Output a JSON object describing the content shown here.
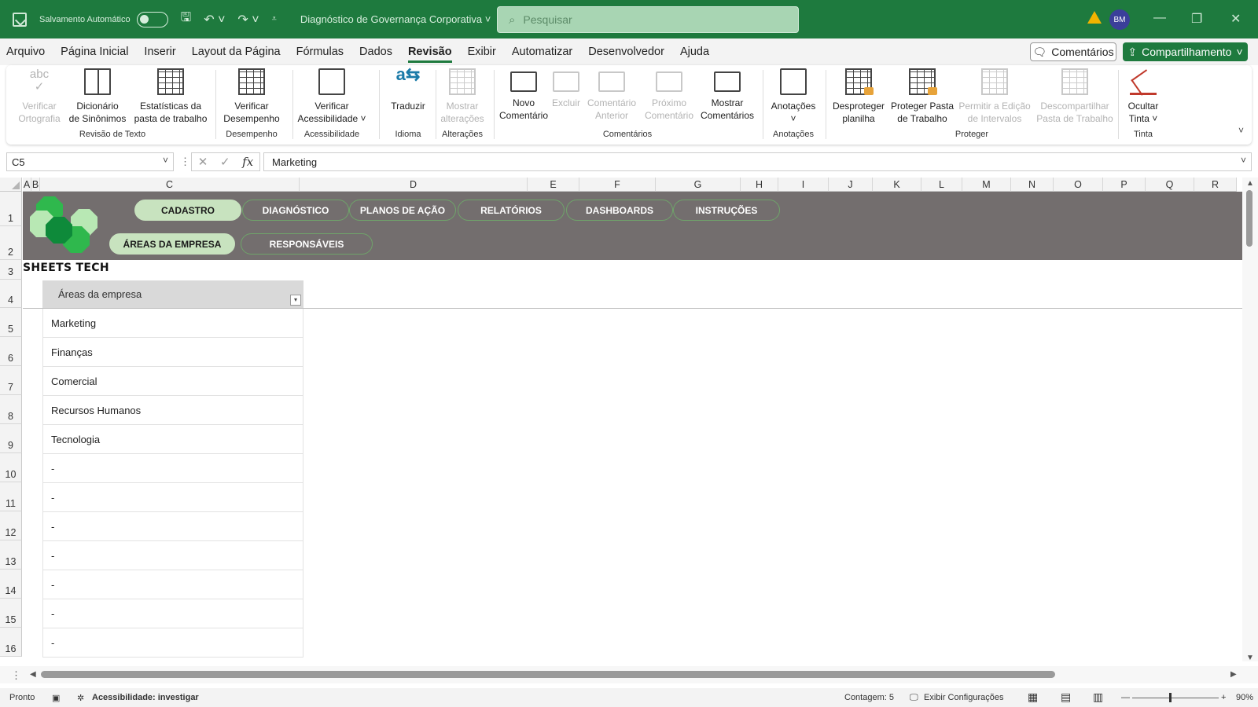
{
  "title_bar": {
    "autosave_label": "Salvamento Automático",
    "document_title": "Diagnóstico de Governança Corporativa",
    "search_placeholder": "Pesquisar",
    "user_initials": "BM"
  },
  "menu": {
    "tabs": [
      "Arquivo",
      "Página Inicial",
      "Inserir",
      "Layout da Página",
      "Fórmulas",
      "Dados",
      "Revisão",
      "Exibir",
      "Automatizar",
      "Desenvolvedor",
      "Ajuda"
    ],
    "active_tab": "Revisão",
    "comments_button": "Comentários",
    "share_button": "Compartilhamento"
  },
  "ribbon": {
    "buttons": {
      "spell": "Verificar\nOrtografia",
      "thesaurus": "Dicionário\nde Sinônimos",
      "stats": "Estatísticas da\npasta de trabalho",
      "performance": "Verificar\nDesempenho",
      "accessibility": "Verificar\nAcessibilidade ˅",
      "translate": "Traduzir",
      "show_changes": "Mostrar\nalterações",
      "new_comment": "Novo\nComentário",
      "delete": "Excluir",
      "prev_comment": "Comentário\nAnterior",
      "next_comment": "Próximo\nComentário",
      "show_comments": "Mostrar\nComentários",
      "notes": "Anotações\n˅",
      "unprotect_sheet": "Desproteger\nplanilha",
      "protect_workbook": "Proteger Pasta\nde Trabalho",
      "allow_edit_ranges": "Permitir a Edição\nde Intervalos",
      "unshare_workbook": "Descompartilhar\nPasta de Trabalho",
      "hide_ink": "Ocultar\nTinta ˅"
    },
    "groups": {
      "proofing": "Revisão de Texto",
      "performance": "Desempenho",
      "accessibility": "Acessibilidade",
      "language": "Idioma",
      "changes": "Alterações",
      "comments": "Comentários",
      "notes": "Anotações",
      "protect": "Proteger",
      "ink": "Tinta"
    }
  },
  "formula_bar": {
    "name_box": "C5",
    "fx": "fx",
    "value": "Marketing"
  },
  "columns": [
    "A",
    "B",
    "C",
    "D",
    "E",
    "F",
    "G",
    "H",
    "I",
    "J",
    "K",
    "L",
    "M",
    "N",
    "O",
    "P",
    "Q",
    "R"
  ],
  "rows": [
    "1",
    "2",
    "3",
    "4",
    "5",
    "6",
    "7",
    "8",
    "9",
    "10",
    "11",
    "12",
    "13",
    "14",
    "15",
    "16"
  ],
  "sheet": {
    "nav_top": [
      "CADASTRO",
      "DIAGNÓSTICO",
      "PLANOS DE AÇÃO",
      "RELATÓRIOS",
      "DASHBOARDS",
      "INSTRUÇÕES"
    ],
    "nav_sub": [
      "ÁREAS DA EMPRESA",
      "RESPONSÁVEIS"
    ],
    "brand": "SHEETS TECH",
    "table_header": "Áreas da empresa",
    "table_rows": [
      "Marketing",
      "Finanças",
      "Comercial",
      "Recursos Humanos",
      "Tecnologia",
      "-",
      "-",
      "-",
      "-",
      "-",
      "-",
      "-"
    ],
    "accent_color": "#1e7a3e",
    "banner_color": "#736e6e",
    "pill_active_color": "#c8e3bf"
  },
  "status_bar": {
    "ready": "Pronto",
    "accessibility": "Acessibilidade: investigar",
    "count": "Contagem: 5",
    "display_settings": "Exibir Configurações",
    "zoom": "90%"
  }
}
